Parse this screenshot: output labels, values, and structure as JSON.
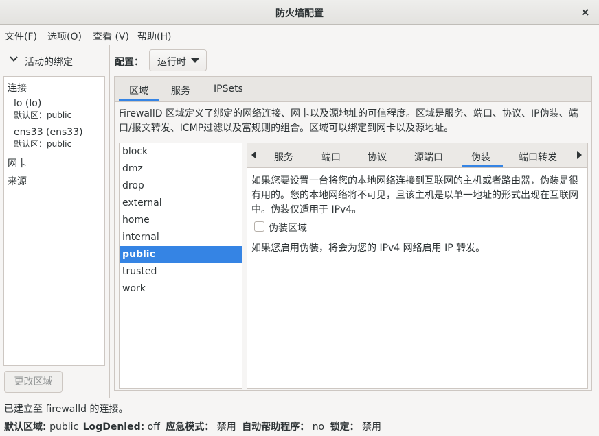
{
  "window": {
    "title": "防火墙配置",
    "close_glyph": "×"
  },
  "menubar": {
    "file": "文件(F)",
    "options": "选项(O)",
    "view": "查看 (V)",
    "help": "帮助(H)"
  },
  "left": {
    "header": "活动的绑定",
    "connections_label": "连接",
    "connections": [
      {
        "name": "lo (lo)",
        "zone": "默认区：public"
      },
      {
        "name": "ens33 (ens33)",
        "zone": "默认区：public"
      }
    ],
    "interfaces_label": "网卡",
    "sources_label": "来源",
    "change_zone_button": "更改区域"
  },
  "config": {
    "label": "配置：",
    "value": "运行时"
  },
  "tabs": [
    "区域",
    "服务",
    "IPSets"
  ],
  "zone_description": "FirewallD 区域定义了绑定的网络连接、网卡以及源地址的可信程度。区域是服务、端口、协议、IP伪装、端口/报文转发、ICMP过滤以及富规则的组合。区域可以绑定到网卡以及源地址。",
  "zones": [
    "block",
    "dmz",
    "drop",
    "external",
    "home",
    "internal",
    "public",
    "trusted",
    "work"
  ],
  "selected_zone": "public",
  "inner_tabs": [
    "服务",
    "端口",
    "协议",
    "源端口",
    "伪装",
    "端口转发"
  ],
  "masquerade": {
    "description": "如果您要设置一台将您的本地网络连接到互联网的主机或者路由器，伪装是很有用的。您的本地网络将不可见，且该主机是以单一地址的形式出现在互联网中。伪装仅适用于 IPv4。",
    "checkbox_label": "伪装区域",
    "checked": false,
    "note": "如果您启用伪装，将会为您的 IPv4 网络启用 IP 转发。"
  },
  "status": {
    "connection": "已建立至 firewalld 的连接。",
    "default_zone_label": "默认区域:",
    "default_zone_value": "public",
    "logdenied_label": "LogDenied:",
    "logdenied_value": "off",
    "panic_label": "应急模式：",
    "panic_value": "禁用",
    "helper_label": "自动帮助程序：",
    "helper_value": "no",
    "lockdown_label": "锁定：",
    "lockdown_value": "禁用"
  },
  "colors": {
    "accent": "#3584e4",
    "window_bg": "#f6f5f4",
    "border": "#cdc7c2"
  }
}
